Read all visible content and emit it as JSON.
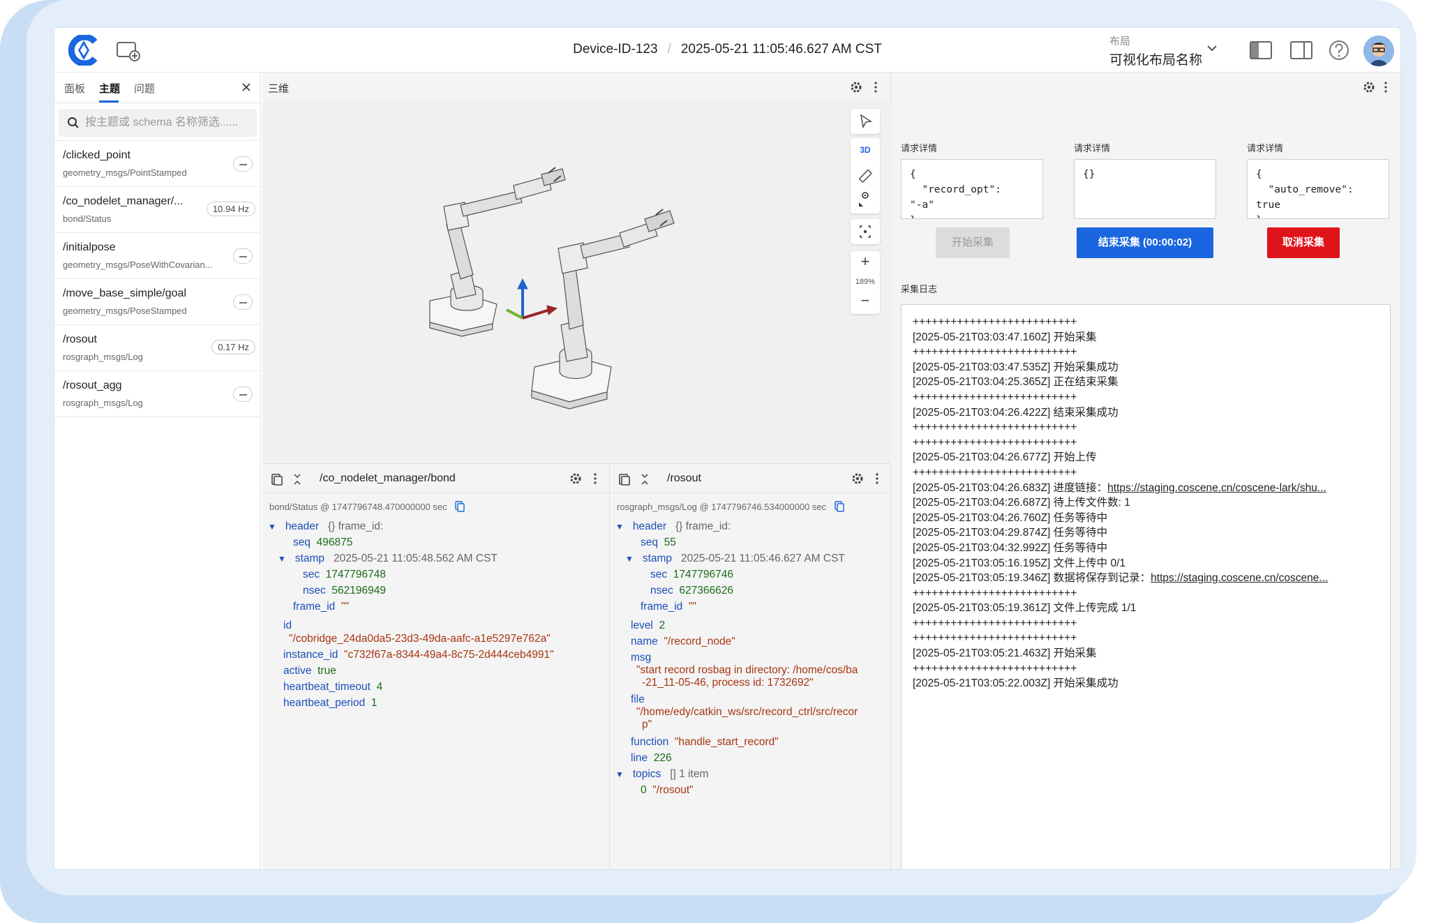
{
  "app": {
    "device_id": "Device-ID-123",
    "timestamp": "2025-05-21 11:05:46.627 AM CST",
    "layout_label": "布局",
    "layout_name": "可视化布局名称",
    "brand_color": "#1a66e0"
  },
  "sidebar": {
    "tabs": [
      "面板",
      "主题",
      "问题"
    ],
    "active_tab": "主题",
    "search_placeholder": "按主题或 schema 名称筛选......",
    "topics": [
      {
        "name": "/clicked_point",
        "schema": "geometry_msgs/PointStamped",
        "hz": ""
      },
      {
        "name": "/co_nodelet_manager/...",
        "schema": "bond/Status",
        "hz": "10.94 Hz"
      },
      {
        "name": "/initialpose",
        "schema": "geometry_msgs/PoseWithCovarian...",
        "hz": ""
      },
      {
        "name": "/move_base_simple/goal",
        "schema": "geometry_msgs/PoseStamped",
        "hz": ""
      },
      {
        "name": "/rosout",
        "schema": "rosgraph_msgs/Log",
        "hz": "0.17 Hz"
      },
      {
        "name": "/rosout_agg",
        "schema": "rosgraph_msgs/Log",
        "hz": ""
      }
    ]
  },
  "panel3d": {
    "title": "三维",
    "mode_3d": "3D",
    "zoom": "189%",
    "zoom_in": "+",
    "zoom_out": "−"
  },
  "bond_panel": {
    "topic": "/co_nodelet_manager/bond",
    "meta": "bond/Status @ 1747796748.470000000 sec",
    "header": "header",
    "header_note": "{} frame_id:",
    "seq_k": "seq",
    "seq_v": "496875",
    "stamp_k": "stamp",
    "stamp_v": "2025-05-21 11:05:48.562 AM CST",
    "sec_k": "sec",
    "sec_v": "1747796748",
    "nsec_k": "nsec",
    "nsec_v": "562196949",
    "frame_id_k": "frame_id",
    "frame_id_v": "\"\"",
    "id_k": "id",
    "id_v": "\"/cobridge_24da0da5-23d3-49da-aafc-a1e5297e762a\"",
    "instance_id_k": "instance_id",
    "instance_id_v": "\"c732f67a-8344-49a4-8c75-2d444ceb4991\"",
    "active_k": "active",
    "active_v": "true",
    "hb_timeout_k": "heartbeat_timeout",
    "hb_timeout_v": "4",
    "hb_period_k": "heartbeat_period",
    "hb_period_v": "1"
  },
  "rosout_panel": {
    "topic": "/rosout",
    "meta": "rosgraph_msgs/Log @ 1747796746.534000000 sec",
    "header": "header",
    "header_note": "{} frame_id:",
    "seq_k": "seq",
    "seq_v": "55",
    "stamp_k": "stamp",
    "stamp_v": "2025-05-21 11:05:46.627 AM CST",
    "sec_k": "sec",
    "sec_v": "1747796746",
    "nsec_k": "nsec",
    "nsec_v": "627366626",
    "frame_id_k": "frame_id",
    "frame_id_v": "\"\"",
    "level_k": "level",
    "level_v": "2",
    "name_k": "name",
    "name_v": "\"/record_node\"",
    "msg_k": "msg",
    "msg_v1": "\"start record rosbag in directory: /home/cos/ba",
    "msg_v2": "-21_11-05-46, process id: 1732692\"",
    "file_k": "file",
    "file_v1": "\"/home/edy/catkin_ws/src/record_ctrl/src/recor",
    "file_v2": "p\"",
    "function_k": "function",
    "function_v": "\"handle_start_record\"",
    "line_k": "line",
    "line_v": "226",
    "topics_k": "topics",
    "topics_note": "[] 1 item",
    "topic0_k": "0",
    "topic0_v": "\"/rosout\""
  },
  "right_panel": {
    "req_label": "请求详情",
    "req_1": "{\n  \"record_opt\":\n\"-a\"\n}",
    "req_2": "{}",
    "req_3": "{\n  \"auto_remove\":\ntrue\n}",
    "btn_start": "开始采集",
    "btn_stop": "结束采集 (00:00:02)",
    "btn_cancel": "取消采集",
    "stop_color": "#1a66e0",
    "cancel_color": "#e0131b",
    "log_label": "采集日志",
    "log_lines": [
      "++++++++++++++++++++++++++",
      "[2025-05-21T03:03:47.160Z] 开始采集",
      "++++++++++++++++++++++++++",
      "[2025-05-21T03:03:47.535Z] 开始采集成功",
      "[2025-05-21T03:04:25.365Z] 正在结束采集",
      "++++++++++++++++++++++++++",
      "[2025-05-21T03:04:26.422Z] 结束采集成功",
      "++++++++++++++++++++++++++",
      "++++++++++++++++++++++++++",
      "[2025-05-21T03:04:26.677Z] 开始上传",
      "++++++++++++++++++++++++++"
    ],
    "log_link1_prefix": "[2025-05-21T03:04:26.683Z] 进度链接：",
    "log_link1": "https://staging.coscene.cn/coscene-lark/shu...",
    "log_lines2": [
      "[2025-05-21T03:04:26.687Z] 待上传文件数: 1",
      "[2025-05-21T03:04:26.760Z] 任务等待中",
      "[2025-05-21T03:04:29.874Z] 任务等待中",
      "[2025-05-21T03:04:32.992Z] 任务等待中",
      "[2025-05-21T03:05:16.195Z] 文件上传中 0/1"
    ],
    "log_link2_prefix": "[2025-05-21T03:05:19.346Z] 数据将保存到记录：",
    "log_link2": "https://staging.coscene.cn/coscene...",
    "log_lines3": [
      "++++++++++++++++++++++++++",
      "[2025-05-21T03:05:19.361Z] 文件上传完成 1/1",
      "++++++++++++++++++++++++++",
      "++++++++++++++++++++++++++",
      "[2025-05-21T03:05:21.463Z] 开始采集",
      "++++++++++++++++++++++++++",
      "[2025-05-21T03:05:22.003Z] 开始采集成功"
    ]
  }
}
